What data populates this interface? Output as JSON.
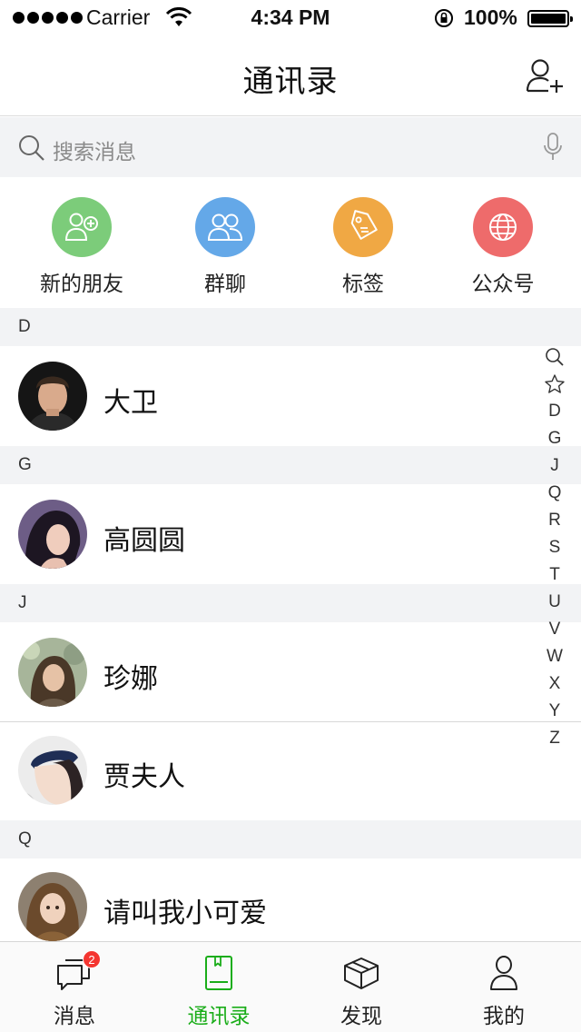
{
  "status_bar": {
    "carrier": "Carrier",
    "time": "4:34 PM",
    "battery_percent": "100%",
    "battery_level": 1.0
  },
  "nav": {
    "title": "通讯录",
    "add_icon": "add-contact-icon"
  },
  "search": {
    "placeholder": "搜索消息",
    "icon": "search-icon",
    "mic_icon": "microphone-icon"
  },
  "quick_actions": [
    {
      "label": "新的朋友",
      "icon": "new-friend-icon",
      "color": "#7ccc7a"
    },
    {
      "label": "群聊",
      "icon": "group-chat-icon",
      "color": "#64a8e8"
    },
    {
      "label": "标签",
      "icon": "tag-icon",
      "color": "#f0a844"
    },
    {
      "label": "公众号",
      "icon": "globe-icon",
      "color": "#ee6b6b"
    }
  ],
  "sections": [
    {
      "letter": "D",
      "contacts": [
        {
          "name": "大卫"
        }
      ]
    },
    {
      "letter": "G",
      "contacts": [
        {
          "name": "高圆圆"
        }
      ]
    },
    {
      "letter": "J",
      "contacts": [
        {
          "name": "珍娜"
        },
        {
          "name": "贾夫人"
        }
      ]
    },
    {
      "letter": "Q",
      "contacts": [
        {
          "name": "请叫我小可爱"
        }
      ]
    }
  ],
  "index_bar": [
    "search",
    "star",
    "D",
    "G",
    "J",
    "Q",
    "R",
    "S",
    "T",
    "U",
    "V",
    "W",
    "X",
    "Y",
    "Z"
  ],
  "tab_bar": {
    "active_color": "#1aad19",
    "tabs": [
      {
        "label": "消息",
        "icon": "chat-bubbles-icon",
        "badge": "2"
      },
      {
        "label": "通讯录",
        "icon": "contacts-book-icon",
        "active": true
      },
      {
        "label": "发现",
        "icon": "discover-box-icon"
      },
      {
        "label": "我的",
        "icon": "person-icon"
      }
    ]
  }
}
